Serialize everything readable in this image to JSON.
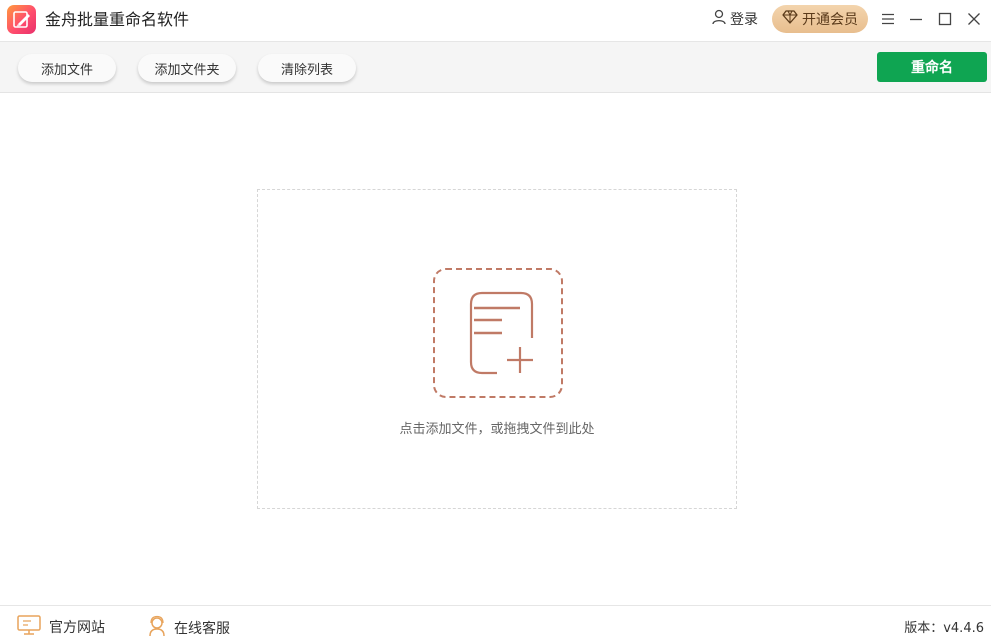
{
  "app": {
    "title": "金舟批量重命名软件",
    "logo_icon": "pen-edit-icon",
    "brand_gradient": [
      "#ff9a3c",
      "#e8306b"
    ]
  },
  "header": {
    "login_label": "登录",
    "login_icon": "user-icon",
    "vip_label": "开通会员",
    "vip_icon": "diamond-icon",
    "menu_icon": "hamburger-menu-icon",
    "minimize_icon": "minimize-icon",
    "maximize_icon": "maximize-icon",
    "close_icon": "close-icon"
  },
  "toolbar": {
    "add_file_label": "添加文件",
    "add_folder_label": "添加文件夹",
    "clear_list_label": "清除列表",
    "rename_label": "重命名",
    "rename_color": "#0fa552"
  },
  "dropzone": {
    "hint": "点击添加文件，或拖拽文件到此处",
    "icon": "add-file-icon",
    "icon_color": "#c07a66"
  },
  "footer": {
    "website_label": "官方网站",
    "website_icon": "monitor-icon",
    "support_label": "在线客服",
    "support_icon": "customer-service-icon",
    "version": "版本：v4.4.6"
  }
}
